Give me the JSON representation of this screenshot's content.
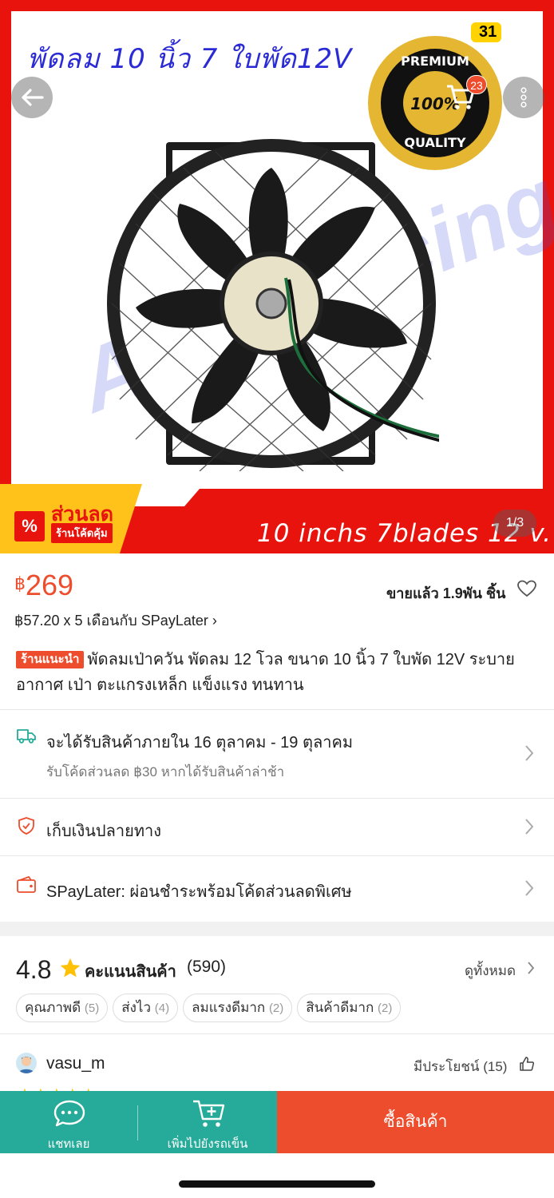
{
  "status": {
    "time": "31"
  },
  "hero": {
    "title_text": "พัดลม 10 นิ้ว 7 ใบพัด12V",
    "watermark_text": "A&N Racing",
    "badge_top": "PREMIUM",
    "badge_mid": "100%",
    "badge_bottom": "QUALITY",
    "banner_text": "10 inchs 7blades 12 v.",
    "sale_tag_title": "ส่วนลด",
    "sale_tag_sub": "ร้านโค้ดคุ้ม",
    "sale_tag_symbol": "%",
    "cart_count": "23",
    "image_counter": "1/3"
  },
  "price": {
    "currency": "฿",
    "amount": "269",
    "sold_text": "ขายแล้ว 1.9พัน ชิ้น",
    "paylater_text": "฿57.20 x 5 เดือนกับ SPayLater",
    "paylater_chevron": "›"
  },
  "product": {
    "tag": "ร้านแนะนำ",
    "title": "พัดลมเป่าควัน พัดลม 12 โวล ขนาด 10 นิ้ว 7 ใบพัด 12V ระบายอากาศ เป่า ตะแกรงเหล็ก แข็งแรง ทนทาน"
  },
  "shipping": {
    "main": "จะได้รับสินค้าภายใน 16 ตุลาคม - 19 ตุลาคม",
    "sub": "รับโค้ดส่วนลด ฿30 หากได้รับสินค้าล่าช้า"
  },
  "cod": {
    "label": "เก็บเงินปลายทาง"
  },
  "spaylater": {
    "label": "SPayLater: ผ่อนชำระพร้อมโค้ดส่วนลดพิเศษ"
  },
  "rating": {
    "score": "4.8",
    "label": "คะแนนสินค้า",
    "count": "(590)",
    "see_all": "ดูทั้งหมด",
    "chips": [
      {
        "label": "คุณภาพดี",
        "count": "(5)"
      },
      {
        "label": "ส่งไว",
        "count": "(4)"
      },
      {
        "label": "ลมแรงดีมาก",
        "count": "(2)"
      },
      {
        "label": "สินค้าดีมาก",
        "count": "(2)"
      }
    ]
  },
  "review": {
    "username": "vasu_m",
    "helpful": "มีประโยชน์ (15)",
    "stars": "★★★★★"
  },
  "bottom_bar": {
    "chat_label": "แชทเลย",
    "cart_label": "เพิ่มไปยังรถเข็น",
    "buy_label": "ซื้อสินค้า"
  },
  "colors": {
    "accent": "#ee4d2d",
    "teal": "#26aa99",
    "hero_red": "#e8130d",
    "star": "#ffc107"
  }
}
